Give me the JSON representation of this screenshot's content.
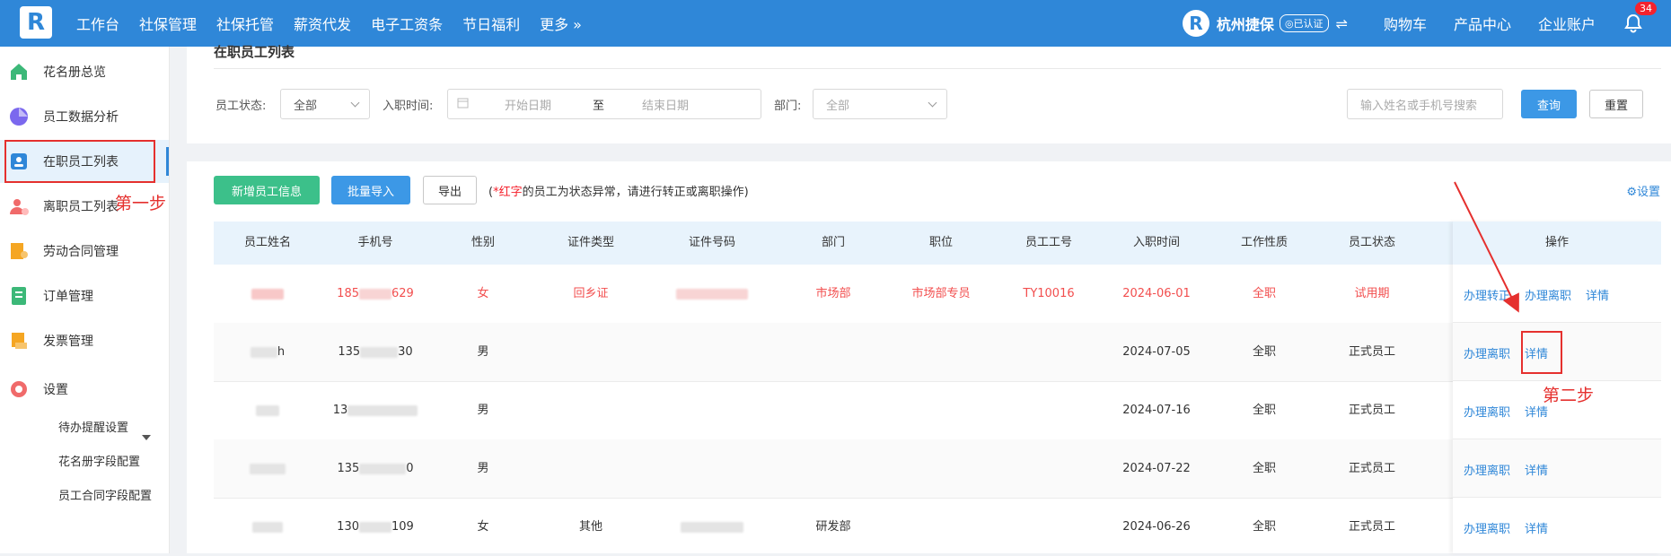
{
  "topbar": {
    "nav": [
      "工作台",
      "社保管理",
      "社保托管",
      "薪资代发",
      "电子工资条",
      "节日福利",
      "更多 »"
    ],
    "company": "杭州捷保",
    "verified": "◎已认证",
    "swap": "⇌",
    "links": [
      "购物车",
      "产品中心",
      "企业账户"
    ],
    "badge": "34"
  },
  "sidebar": {
    "items": [
      {
        "label": "花名册总览",
        "icon": "home-icon",
        "color": "#3cb878"
      },
      {
        "label": "员工数据分析",
        "icon": "pie-chart-icon",
        "color": "#7b68ee"
      },
      {
        "label": "在职员工列表",
        "icon": "id-badge-icon",
        "color": "#2f87d8"
      },
      {
        "label": "离职员工列表",
        "icon": "user-leave-icon",
        "color": "#f06a6a"
      },
      {
        "label": "劳动合同管理",
        "icon": "contract-icon",
        "color": "#f5a623"
      },
      {
        "label": "订单管理",
        "icon": "order-icon",
        "color": "#3cb878"
      },
      {
        "label": "发票管理",
        "icon": "invoice-icon",
        "color": "#f5a623"
      },
      {
        "label": "设置",
        "icon": "gear-icon",
        "color": "#f06a6a"
      }
    ],
    "sub_items": [
      "待办提醒设置",
      "花名册字段配置",
      "员工合同字段配置"
    ]
  },
  "page": {
    "title": "在职员工列表",
    "filters": {
      "status_label": "员工状态:",
      "status_value": "全部",
      "hire_label": "入职时间:",
      "start_placeholder": "开始日期",
      "to": "至",
      "end_placeholder": "结束日期",
      "dept_label": "部门:",
      "dept_value": "全部",
      "search_placeholder": "输入姓名或手机号搜索",
      "query": "查询",
      "reset": "重置"
    },
    "actions": {
      "add": "新增员工信息",
      "import": "批量导入",
      "export": "导出",
      "note_open": "(",
      "note_red": "*红字",
      "note_rest": "的员工为状态异常，请进行转正或离职操作)",
      "settings": "⚙设置"
    }
  },
  "table": {
    "columns": [
      "员工姓名",
      "手机号",
      "性别",
      "证件类型",
      "证件号码",
      "部门",
      "职位",
      "员工工号",
      "入职时间",
      "工作性质",
      "员工状态",
      "操作"
    ],
    "rows": [
      {
        "name": "",
        "phone_a": "185",
        "phone_b": "629",
        "gender": "女",
        "id_type": "回乡证",
        "dept": "市场部",
        "position": "市场部专员",
        "emp_no": "TY10016",
        "date": "2024-06-01",
        "nature": "全职",
        "status": "试用期",
        "ops": [
          "办理转正",
          "办理离职",
          "详情"
        ]
      },
      {
        "name": "h",
        "phone_a": "135",
        "phone_b": "30",
        "gender": "男",
        "id_type": "",
        "dept": "",
        "position": "",
        "emp_no": "",
        "date": "2024-07-05",
        "nature": "全职",
        "status": "正式员工",
        "ops": [
          "办理离职",
          "详情"
        ]
      },
      {
        "name": "",
        "phone_a": "13",
        "phone_b": "",
        "gender": "男",
        "id_type": "",
        "dept": "",
        "position": "",
        "emp_no": "",
        "date": "2024-07-16",
        "nature": "全职",
        "status": "正式员工",
        "ops": [
          "办理离职",
          "详情"
        ]
      },
      {
        "name": "",
        "phone_a": "135",
        "phone_b": "0",
        "gender": "男",
        "id_type": "",
        "dept": "",
        "position": "",
        "emp_no": "",
        "date": "2024-07-22",
        "nature": "全职",
        "status": "正式员工",
        "ops": [
          "办理离职",
          "详情"
        ]
      },
      {
        "name": "",
        "phone_a": "130",
        "phone_b": "109",
        "gender": "女",
        "id_type": "其他",
        "dept": "研发部",
        "position": "",
        "emp_no": "",
        "date": "2024-06-26",
        "nature": "全职",
        "status": "正式员工",
        "ops": [
          "办理离职",
          "详情"
        ]
      }
    ]
  },
  "annotations": {
    "step1": "第一步",
    "step2": "第二步"
  },
  "colors": {
    "primary": "#2f87d8",
    "green": "#3cc08a",
    "alert": "#f24e4e",
    "annotation": "#e5302e"
  }
}
